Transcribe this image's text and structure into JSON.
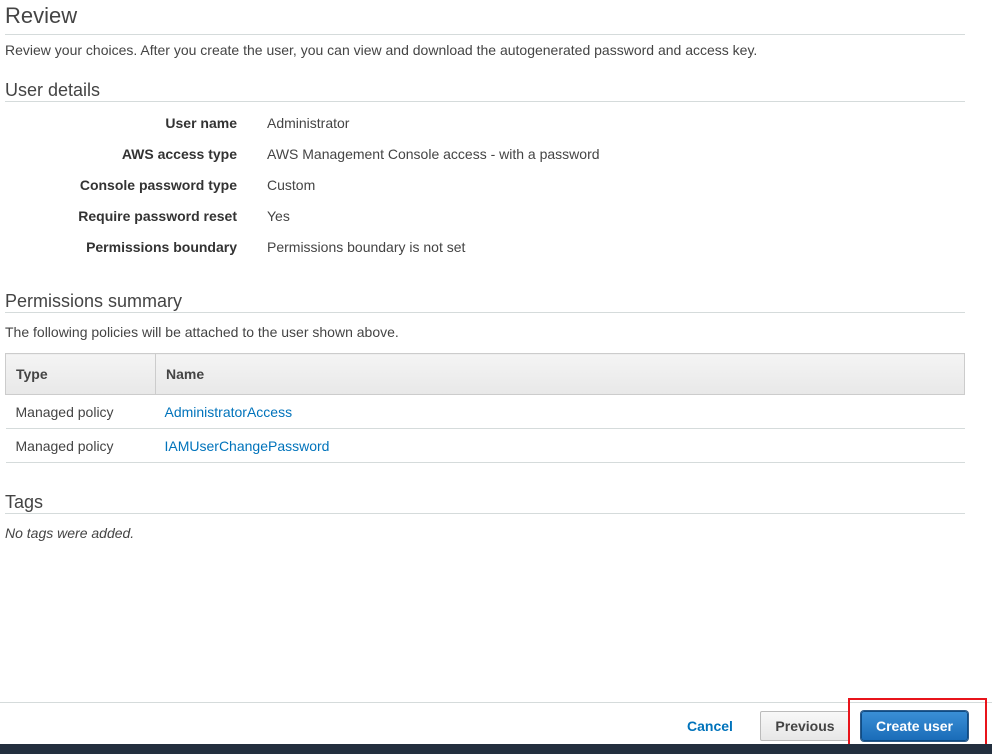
{
  "review": {
    "title": "Review",
    "intro": "Review your choices. After you create the user, you can view and download the autogenerated password and access key."
  },
  "user_details": {
    "title": "User details",
    "rows": [
      {
        "label": "User name",
        "value": "Administrator"
      },
      {
        "label": "AWS access type",
        "value": "AWS Management Console access - with a password"
      },
      {
        "label": "Console password type",
        "value": "Custom"
      },
      {
        "label": "Require password reset",
        "value": "Yes"
      },
      {
        "label": "Permissions boundary",
        "value": "Permissions boundary is not set"
      }
    ]
  },
  "permissions": {
    "title": "Permissions summary",
    "description": "The following policies will be attached to the user shown above.",
    "columns": [
      "Type",
      "Name"
    ],
    "rows": [
      {
        "type": "Managed policy",
        "name": "AdministratorAccess"
      },
      {
        "type": "Managed policy",
        "name": "IAMUserChangePassword"
      }
    ]
  },
  "tags": {
    "title": "Tags",
    "empty_message": "No tags were added."
  },
  "footer": {
    "cancel_label": "Cancel",
    "previous_label": "Previous",
    "create_label": "Create user"
  },
  "colors": {
    "link": "#0073bb",
    "primary_button": "#1a6cb8",
    "highlight": "#e8141b",
    "bottom_bar": "#232f3e"
  }
}
